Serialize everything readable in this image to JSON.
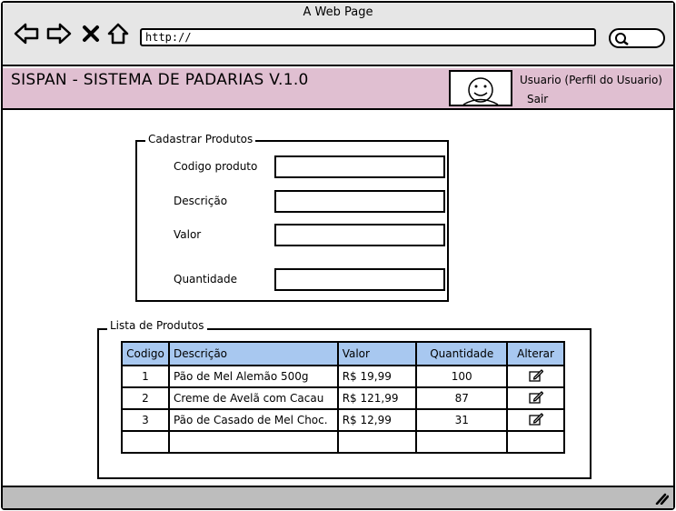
{
  "browser": {
    "title": "A Web Page",
    "url": "http://"
  },
  "header": {
    "app_title": "SISPAN - SISTEMA DE PADARIAS V.1.0",
    "user_label": "Usuario (Perfil do Usuario)",
    "logout": "Sair"
  },
  "form": {
    "legend": "Cadastrar Produtos",
    "fields": [
      {
        "label": "Codigo produto",
        "value": ""
      },
      {
        "label": "Descrição",
        "value": ""
      },
      {
        "label": "Valor",
        "value": ""
      },
      {
        "label": "Quantidade",
        "value": ""
      }
    ]
  },
  "list": {
    "legend": "Lista de Produtos",
    "columns": [
      "Codigo",
      "Descrição",
      "Valor",
      "Quantidade",
      "Alterar"
    ],
    "rows": [
      {
        "codigo": "1",
        "descricao": "Pão de Mel Alemão 500g",
        "valor": "R$ 19,99",
        "quantidade": "100",
        "alterar_icon": "edit-icon"
      },
      {
        "codigo": "2",
        "descricao": "Creme de Avelã com Cacau",
        "valor": "R$ 121,99",
        "quantidade": "87",
        "alterar_icon": "edit-icon"
      },
      {
        "codigo": "3",
        "descricao": "Pão de Casado de Mel Choc.",
        "valor": "R$ 12,99",
        "quantidade": "31",
        "alterar_icon": "edit-icon"
      }
    ]
  },
  "colors": {
    "header_bg": "#e0bfd1",
    "table_header_bg": "#a8c8f0",
    "chrome_bg": "#e6e6e6",
    "footer_bg": "#bdbdbd"
  },
  "icons": {
    "back": "arrow-left-icon",
    "forward": "arrow-right-icon",
    "stop": "close-icon",
    "home": "home-icon",
    "search": "search-icon",
    "avatar": "avatar",
    "edit": "edit-icon",
    "resize": "resize-grip-icon"
  }
}
